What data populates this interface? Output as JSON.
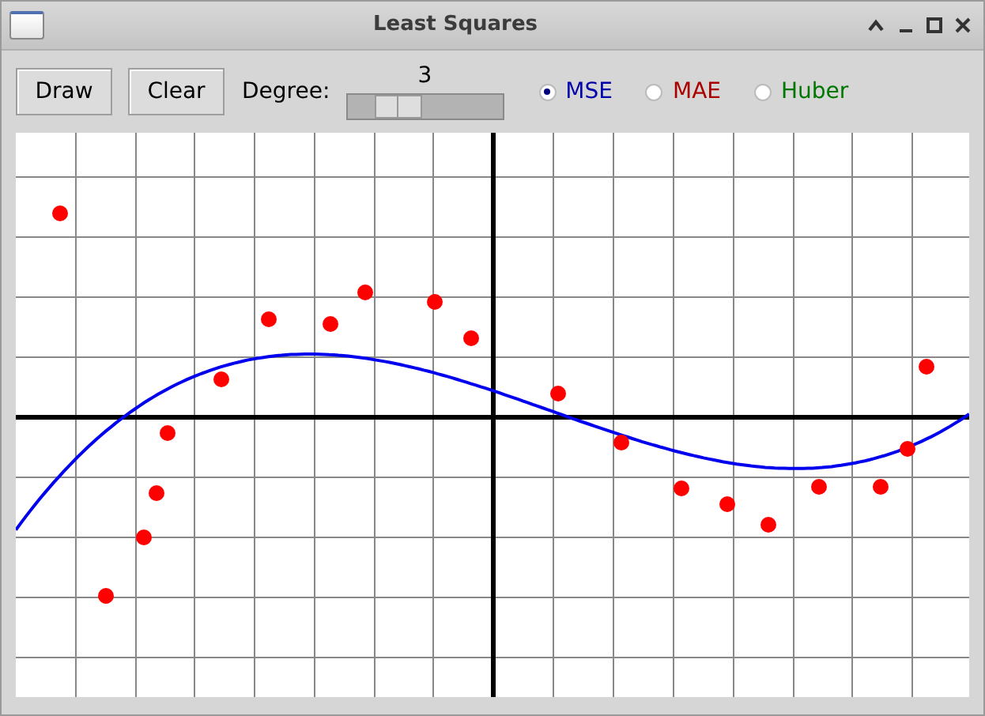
{
  "window": {
    "title": "Least Squares"
  },
  "toolbar": {
    "buttons": [
      "Draw",
      "Clear"
    ],
    "degree": {
      "label": "Degree:",
      "reading": "3",
      "level": 0.26
    },
    "loss_options": [
      {
        "label": "MSE",
        "selected": true,
        "color": "#0000aa"
      },
      {
        "label": "MAE",
        "selected": false,
        "color": "#aa0000"
      },
      {
        "label": "Huber",
        "selected": false,
        "color": "#007700"
      }
    ]
  }
}
